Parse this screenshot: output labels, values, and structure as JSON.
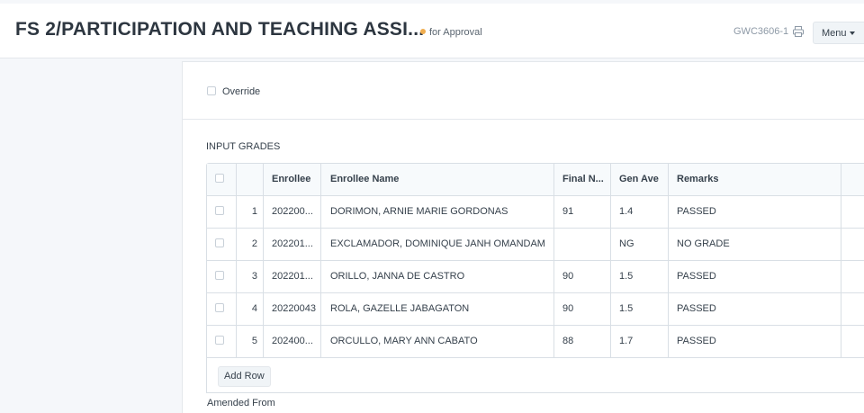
{
  "header": {
    "title": "FS 2/PARTICIPATION AND TEACHING ASSI...",
    "status": "for Approval",
    "status_color": "#f0ad4e",
    "doc_id": "GWC3606-1",
    "print_icon": "printer-icon",
    "menu_label": "Menu"
  },
  "form": {
    "override_label": "Override",
    "section_label": "INPUT GRADES",
    "grid": {
      "columns": [
        "Enrollee",
        "Enrollee Name",
        "Final N...",
        "Gen Ave",
        "Remarks"
      ],
      "rows": [
        {
          "idx": "1",
          "enrollee": "202200...",
          "name": "DORIMON, ARNIE MARIE GORDONAS",
          "final": "91",
          "gen_ave": "1.4",
          "remarks": "PASSED"
        },
        {
          "idx": "2",
          "enrollee": "202201...",
          "name": "EXCLAMADOR, DOMINIQUE JANH OMANDAM",
          "final": "",
          "gen_ave": "NG",
          "remarks": "NO GRADE"
        },
        {
          "idx": "3",
          "enrollee": "202201...",
          "name": "ORILLO, JANNA DE CASTRO",
          "final": "90",
          "gen_ave": "1.5",
          "remarks": "PASSED"
        },
        {
          "idx": "4",
          "enrollee": "20220043",
          "name": "ROLA, GAZELLE JABAGATON",
          "final": "90",
          "gen_ave": "1.5",
          "remarks": "PASSED"
        },
        {
          "idx": "5",
          "enrollee": "202400...",
          "name": "ORCULLO, MARY ANN CABATO",
          "final": "88",
          "gen_ave": "1.7",
          "remarks": "PASSED"
        }
      ],
      "add_row_label": "Add Row"
    },
    "amended_from_label": "Amended From"
  }
}
